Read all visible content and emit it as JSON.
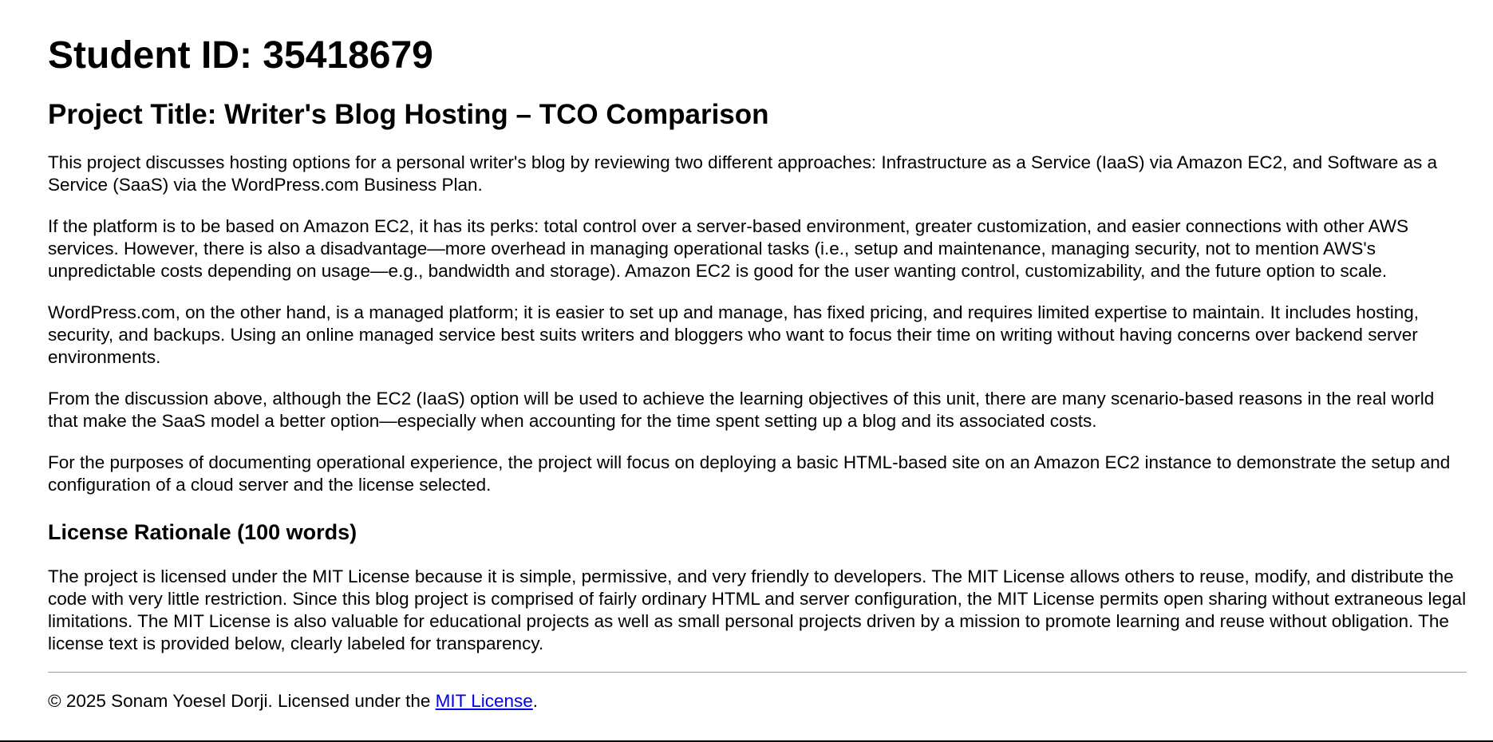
{
  "header": {
    "student_id": "Student ID: 35418679",
    "project_title": "Project Title: Writer's Blog Hosting – TCO Comparison"
  },
  "intro": {
    "paragraphs": [
      "This project discusses hosting options for a personal writer's blog by reviewing two different approaches: Infrastructure as a Service (IaaS) via Amazon EC2, and Software as a Service (SaaS) via the WordPress.com Business Plan.",
      "If the platform is to be based on Amazon EC2, it has its perks: total control over a server-based environment, greater customization, and easier connections with other AWS services. However, there is also a disadvantage—more overhead in managing operational tasks (i.e., setup and maintenance, managing security, not to mention AWS's unpredictable costs depending on usage—e.g., bandwidth and storage). Amazon EC2 is good for the user wanting control, customizability, and the future option to scale.",
      "WordPress.com, on the other hand, is a managed platform; it is easier to set up and manage, has fixed pricing, and requires limited expertise to maintain. It includes hosting, security, and backups. Using an online managed service best suits writers and bloggers who want to focus their time on writing without having concerns over backend server environments.",
      "From the discussion above, although the EC2 (IaaS) option will be used to achieve the learning objectives of this unit, there are many scenario-based reasons in the real world that make the SaaS model a better option—especially when accounting for the time spent setting up a blog and its associated costs.",
      "For the purposes of documenting operational experience, the project will focus on deploying a basic HTML-based site on an Amazon EC2 instance to demonstrate the setup and configuration of a cloud server and the license selected."
    ]
  },
  "license_section": {
    "heading": "License Rationale (100 words)",
    "text": "The project is licensed under the MIT License because it is simple, permissive, and very friendly to developers. The MIT License allows others to reuse, modify, and distribute the code with very little restriction. Since this blog project is comprised of fairly ordinary HTML and server configuration, the MIT License permits open sharing without extraneous legal limitations. The MIT License is also valuable for educational projects as well as small personal projects driven by a mission to promote learning and reuse without obligation. The license text is provided below, clearly labeled for transparency."
  },
  "footer": {
    "text": "© 2025 Sonam Yoesel Dorji. Licensed under the ",
    "link_label": "MIT License",
    "suffix": ".",
    "link_color": "#0000ee"
  }
}
